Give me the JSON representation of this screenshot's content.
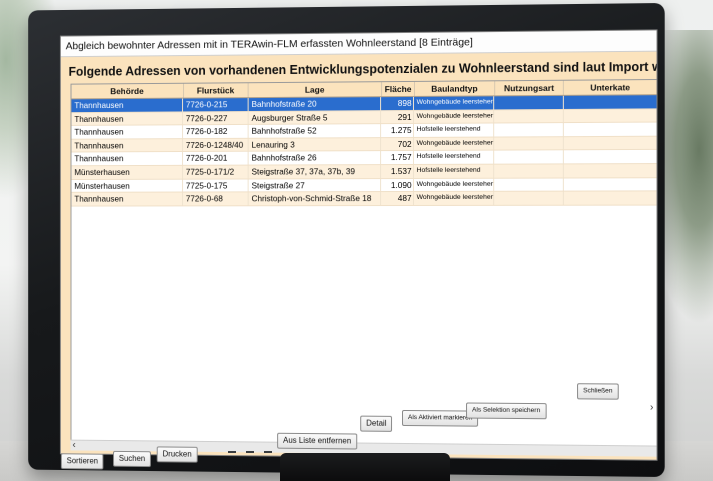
{
  "window": {
    "title": "Abgleich bewohnter Adressen mit in TERAwin-FLM erfassten Wohnleerstand [8 Einträge]",
    "heading": "Folgende Adressen von vorhandenen Entwicklungspotenzialen zu Wohnleerstand sind laut Import wieder bewohnt"
  },
  "table": {
    "columns": [
      "Behörde",
      "Flurstück",
      "Lage",
      "Fläche",
      "Baulandtyp",
      "Nutzungsart",
      "Unterkate"
    ],
    "rows": [
      {
        "behoerde": "Thannhausen",
        "flurstueck": "7726-0-215",
        "lage": "Bahnhofstraße 20",
        "flaeche": "898",
        "baulandtyp": "Wohngebäude leerstehend",
        "selected": true
      },
      {
        "behoerde": "Thannhausen",
        "flurstueck": "7726-0-227",
        "lage": "Augsburger Straße 5",
        "flaeche": "291",
        "baulandtyp": "Wohngebäude leerstehend"
      },
      {
        "behoerde": "Thannhausen",
        "flurstueck": "7726-0-182",
        "lage": "Bahnhofstraße 52",
        "flaeche": "1.275",
        "baulandtyp": "Hofstelle leerstehend"
      },
      {
        "behoerde": "Thannhausen",
        "flurstueck": "7726-0-1248/40",
        "lage": "Lenauring 3",
        "flaeche": "702",
        "baulandtyp": "Wohngebäude leerstehend"
      },
      {
        "behoerde": "Thannhausen",
        "flurstueck": "7726-0-201",
        "lage": "Bahnhofstraße 26",
        "flaeche": "1.757",
        "baulandtyp": "Hofstelle leerstehend"
      },
      {
        "behoerde": "Münsterhausen",
        "flurstueck": "7725-0-171/2",
        "lage": "Steigstraße 37, 37a, 37b, 39",
        "flaeche": "1.537",
        "baulandtyp": "Hofstelle leerstehend"
      },
      {
        "behoerde": "Münsterhausen",
        "flurstueck": "7725-0-175",
        "lage": "Steigstraße 27",
        "flaeche": "1.090",
        "baulandtyp": "Wohngebäude leerstehend"
      },
      {
        "behoerde": "Thannhausen",
        "flurstueck": "7726-0-68",
        "lage": "Christoph-von-Schmid-Straße 18",
        "flaeche": "487",
        "baulandtyp": "Wohngebäude leerstehend"
      }
    ]
  },
  "buttons": {
    "sortieren": "Sortieren",
    "suchen": "Suchen",
    "drucken": "Drucken",
    "aus_liste": "Aus Liste entfernen",
    "detail": "Detail",
    "als_aktiviert": "Als Aktiviert markieren",
    "als_selektion": "Als Selektion speichern",
    "schliessen": "Schließen"
  },
  "colors": {
    "window_bg": "#fbe3bd",
    "selection": "#2a6dce"
  }
}
